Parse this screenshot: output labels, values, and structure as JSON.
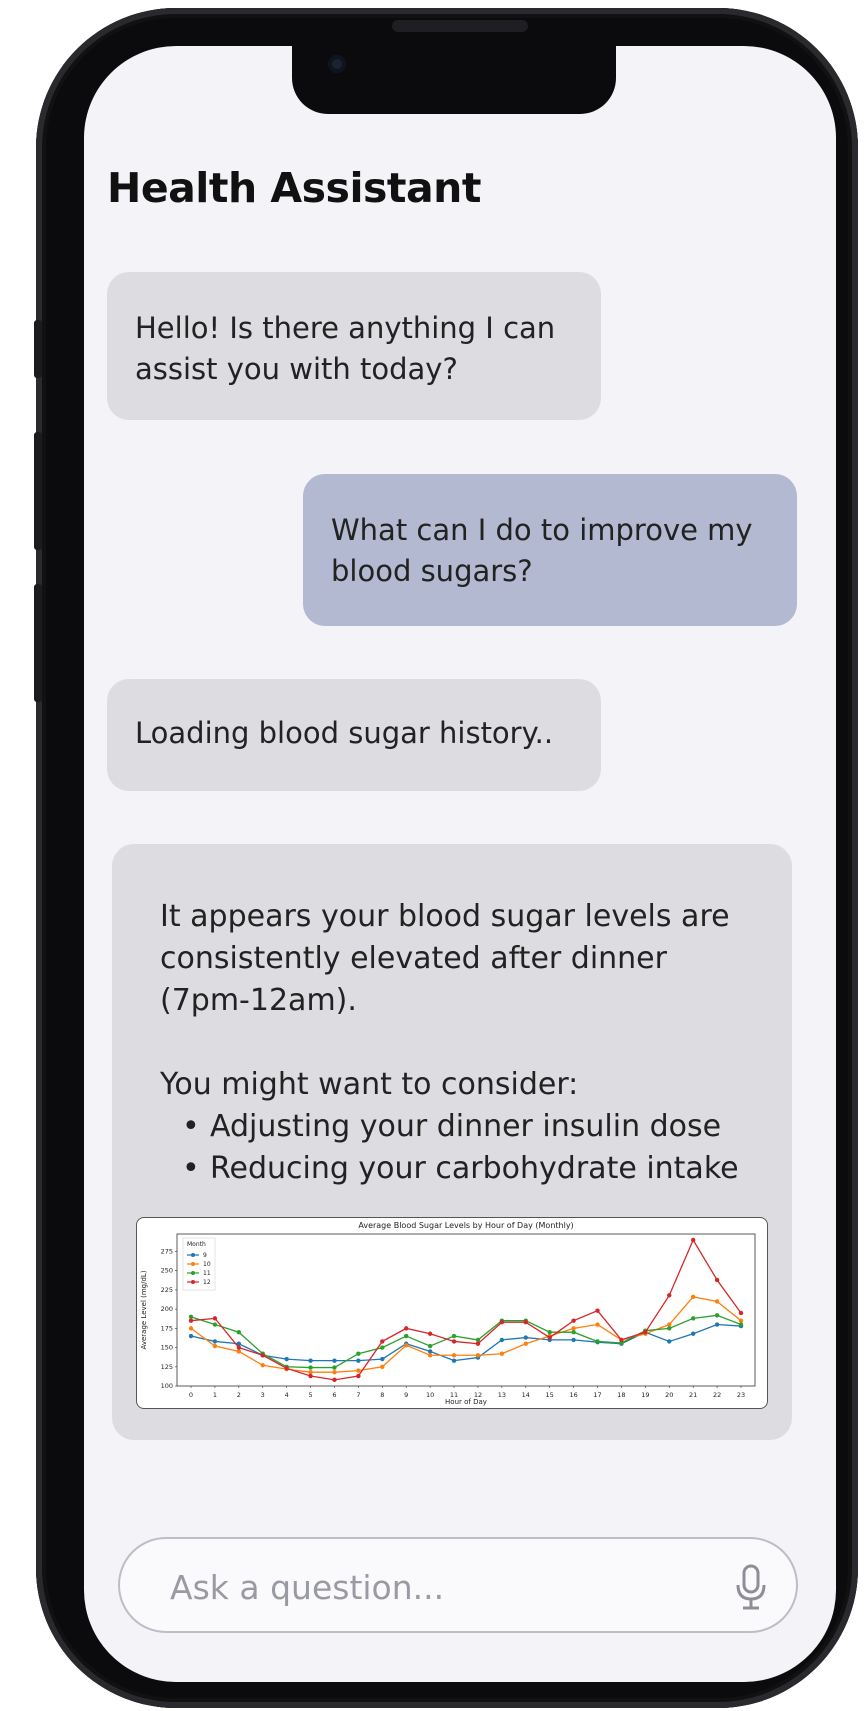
{
  "app": {
    "title": "Health Assistant"
  },
  "messages": [
    {
      "role": "assistant",
      "text": "Hello! Is there anything I can assist you with today?"
    },
    {
      "role": "user",
      "text": "What can I do to improve my blood sugars?"
    },
    {
      "role": "assistant",
      "text": "Loading blood sugar history.."
    },
    {
      "role": "assistant",
      "text": "It appears your blood sugar levels are consistently elevated after dinner (7pm-12am).",
      "consider": "You might want to consider:",
      "bullets": [
        "Adjusting your dinner insulin dose",
        "Reducing your carbohydrate intake"
      ]
    }
  ],
  "chart_data": {
    "type": "line",
    "title": "Average Blood Sugar Levels by Hour of Day (Monthly)",
    "xlabel": "Hour of Day",
    "ylabel": "Average Level (mg/dL)",
    "legend_title": "Month",
    "legend_position": "top-left",
    "x": [
      0,
      1,
      2,
      3,
      4,
      5,
      6,
      7,
      8,
      9,
      10,
      11,
      12,
      13,
      14,
      15,
      16,
      17,
      18,
      19,
      20,
      21,
      22,
      23
    ],
    "ylim": [
      100,
      290
    ],
    "yticks": [
      100,
      125,
      150,
      175,
      200,
      225,
      250,
      275
    ],
    "series": [
      {
        "name": "9",
        "color": "#1f77b4",
        "values": [
          165,
          158,
          155,
          140,
          135,
          133,
          133,
          133,
          135,
          155,
          145,
          133,
          137,
          160,
          163,
          160,
          160,
          157,
          155,
          170,
          158,
          168,
          180,
          178
        ]
      },
      {
        "name": "10",
        "color": "#ff7f0e",
        "values": [
          175,
          152,
          145,
          127,
          122,
          118,
          118,
          120,
          125,
          153,
          140,
          140,
          140,
          142,
          155,
          165,
          175,
          180,
          160,
          168,
          180,
          216,
          210,
          185
        ]
      },
      {
        "name": "11",
        "color": "#2ca02c",
        "values": [
          190,
          180,
          170,
          142,
          125,
          124,
          124,
          142,
          150,
          165,
          152,
          165,
          160,
          185,
          185,
          170,
          170,
          158,
          156,
          172,
          175,
          188,
          192,
          180
        ]
      },
      {
        "name": "12",
        "color": "#d62728",
        "values": [
          185,
          188,
          150,
          140,
          123,
          113,
          108,
          113,
          158,
          175,
          168,
          158,
          155,
          183,
          183,
          163,
          185,
          198,
          160,
          170,
          218,
          290,
          238,
          195
        ]
      }
    ]
  },
  "input": {
    "placeholder": "Ask a question..."
  },
  "icons": {
    "mic": "microphone-icon",
    "camera": "camera-icon"
  }
}
